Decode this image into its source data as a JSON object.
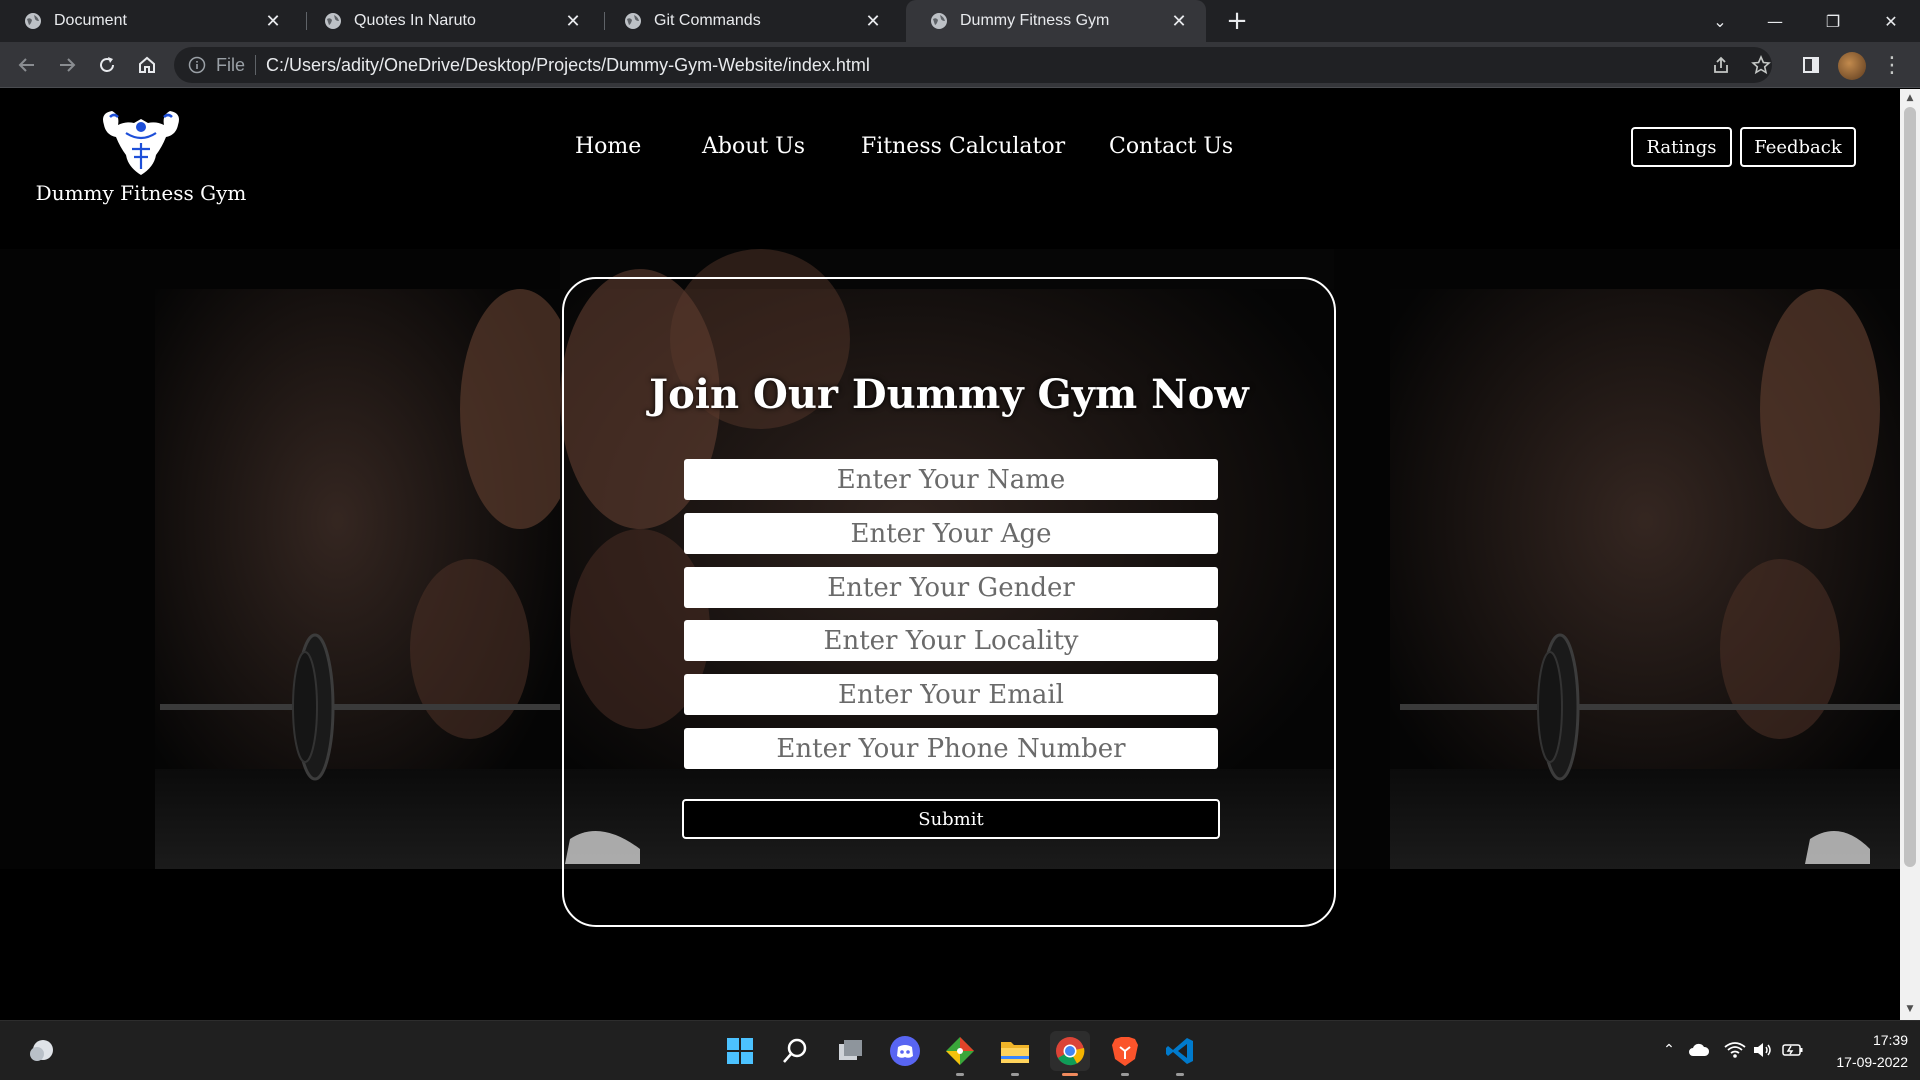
{
  "browser": {
    "tabs": [
      {
        "title": "Document",
        "active": false
      },
      {
        "title": "Quotes In Naruto",
        "active": false
      },
      {
        "title": "Git Commands",
        "active": false
      },
      {
        "title": "Dummy Fitness Gym",
        "active": true
      }
    ],
    "omnibox": {
      "scheme_label": "File",
      "url": "C:/Users/adity/OneDrive/Desktop/Projects/Dummy-Gym-Website/index.html"
    }
  },
  "site": {
    "brand": "Dummy Fitness Gym",
    "nav": [
      "Home",
      "About Us",
      "Fitness Calculator",
      "Contact Us"
    ],
    "header_buttons": {
      "ratings": "Ratings",
      "feedback": "Feedback"
    },
    "form": {
      "title": "Join Our Dummy Gym Now",
      "name_placeholder": "Enter Your Name",
      "age_placeholder": "Enter Your Age",
      "gender_placeholder": "Enter Your Gender",
      "locality_placeholder": "Enter Your Locality",
      "email_placeholder": "Enter Your Email",
      "phone_placeholder": "Enter Your Phone Number",
      "submit_label": "Submit"
    }
  },
  "taskbar": {
    "time": "17:39",
    "date": "17-09-2022"
  }
}
